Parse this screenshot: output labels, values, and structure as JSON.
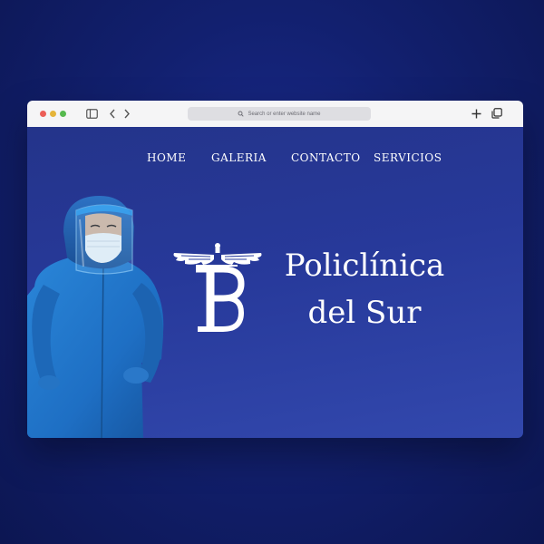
{
  "browser": {
    "address_placeholder": "Search or enter website name"
  },
  "nav": {
    "home": "HOME",
    "galeria": "GALERIA",
    "contacto": "CONTACTO",
    "servicios": "SERVICIOS"
  },
  "hero": {
    "brand_line1": "Policlínica",
    "brand_line2": "del Sur",
    "logo_icon": "winged-ps-monogram-icon"
  },
  "colors": {
    "background": "#12206f",
    "page_gradient_start": "#24348a",
    "page_gradient_end": "#3248ad",
    "text": "#ffffff",
    "scrubs": "#1e73c8"
  }
}
